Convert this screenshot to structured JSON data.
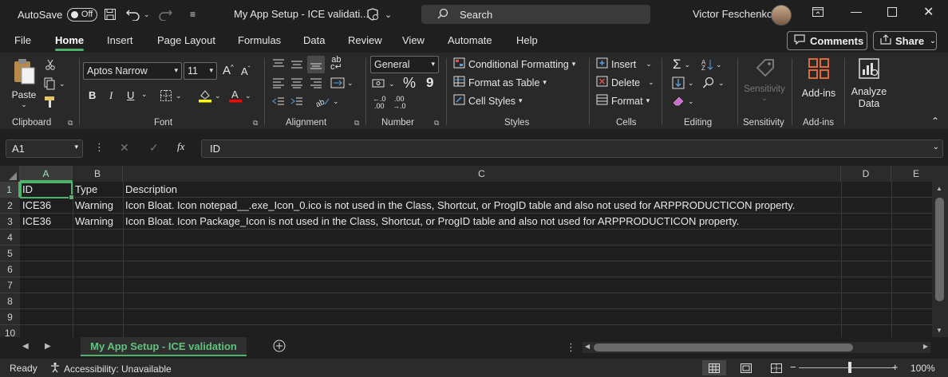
{
  "titlebar": {
    "autosave_label": "AutoSave",
    "autosave_state": "Off",
    "doc_title": "My App Setup - ICE validati...",
    "search_label": "Search",
    "user_name": "Victor Feschenko"
  },
  "menu": {
    "tabs": [
      "File",
      "Home",
      "Insert",
      "Page Layout",
      "Formulas",
      "Data",
      "Review",
      "View",
      "Automate",
      "Help"
    ],
    "active": "Home",
    "comments_label": "Comments",
    "share_label": "Share"
  },
  "ribbon": {
    "clipboard": {
      "label": "Clipboard",
      "paste": "Paste"
    },
    "font": {
      "label": "Font",
      "family": "Aptos Narrow",
      "size": "11",
      "bold": "B",
      "italic": "I",
      "underline": "U",
      "grow": "A",
      "shrink": "A"
    },
    "alignment": {
      "label": "Alignment"
    },
    "number": {
      "label": "Number",
      "format": "General",
      "percent": "%",
      "comma": "9"
    },
    "styles": {
      "label": "Styles",
      "conditional": "Conditional Formatting",
      "format_table": "Format as Table",
      "cell_styles": "Cell Styles"
    },
    "cells": {
      "label": "Cells",
      "insert": "Insert",
      "delete": "Delete",
      "format": "Format"
    },
    "editing": {
      "label": "Editing"
    },
    "sensitivity": {
      "label": "Sensitivity",
      "button": "Sensitivity"
    },
    "addins": {
      "label": "Add-ins",
      "button": "Add-ins"
    },
    "analyze": {
      "line1": "Analyze",
      "line2": "Data"
    }
  },
  "formula_bar": {
    "name_box": "A1",
    "fx": "fx",
    "content": "ID"
  },
  "grid": {
    "columns": [
      "A",
      "B",
      "C",
      "D",
      "E"
    ],
    "rows": [
      "1",
      "2",
      "3",
      "4",
      "5",
      "6",
      "7",
      "8",
      "9",
      "10"
    ],
    "data": [
      [
        "ID",
        "Type",
        "Description"
      ],
      [
        "ICE36",
        "Warning",
        "Icon Bloat. Icon notepad__.exe_Icon_0.ico is not used in the Class, Shortcut, or ProgID table and also not used for ARPPRODUCTICON property."
      ],
      [
        "ICE36",
        "Warning",
        "Icon Bloat. Icon Package_Icon is not used in the Class, Shortcut, or ProgID table and also not used for ARPPRODUCTICON property."
      ]
    ]
  },
  "sheets": {
    "active": "My App Setup - ICE validation"
  },
  "status": {
    "ready": "Ready",
    "accessibility": "Accessibility: Unavailable",
    "zoom": "100%"
  },
  "colors": {
    "accent": "#4fb36b",
    "background": "#1f1f1f",
    "ribbon": "#292929"
  }
}
